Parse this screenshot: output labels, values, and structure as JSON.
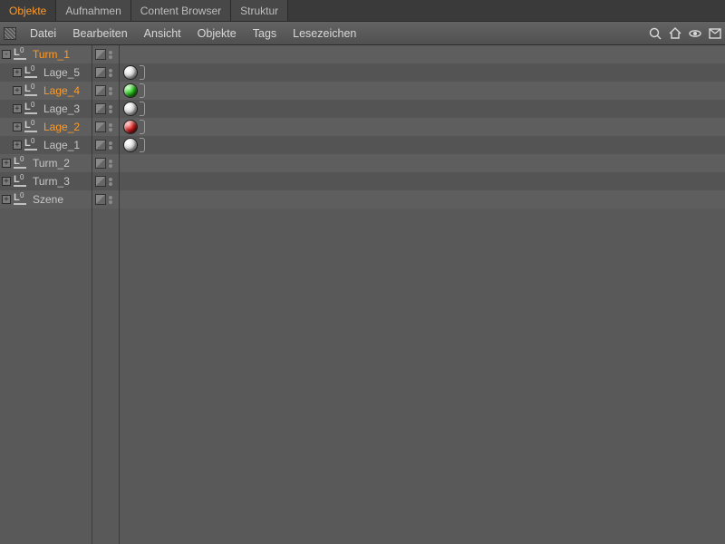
{
  "tabs": [
    {
      "label": "Objekte",
      "active": true
    },
    {
      "label": "Aufnahmen",
      "active": false
    },
    {
      "label": "Content Browser",
      "active": false
    },
    {
      "label": "Struktur",
      "active": false
    }
  ],
  "menu": {
    "items": [
      "Datei",
      "Bearbeiten",
      "Ansicht",
      "Objekte",
      "Tags",
      "Lesezeichen"
    ],
    "right_icons": [
      "search-icon",
      "home-icon",
      "eye-icon",
      "panel-icon"
    ]
  },
  "tree": [
    {
      "name": "Turm_1",
      "depth": 0,
      "expander": "-",
      "highlight": true,
      "tag": null
    },
    {
      "name": "Lage_5",
      "depth": 1,
      "expander": "+",
      "highlight": false,
      "tag": "white"
    },
    {
      "name": "Lage_4",
      "depth": 1,
      "expander": "+",
      "highlight": true,
      "tag": "green"
    },
    {
      "name": "Lage_3",
      "depth": 1,
      "expander": "+",
      "highlight": false,
      "tag": "white"
    },
    {
      "name": "Lage_2",
      "depth": 1,
      "expander": "+",
      "highlight": true,
      "tag": "red"
    },
    {
      "name": "Lage_1",
      "depth": 1,
      "expander": "+",
      "highlight": false,
      "tag": "white"
    },
    {
      "name": "Turm_2",
      "depth": 0,
      "expander": "+",
      "highlight": false,
      "tag": null
    },
    {
      "name": "Turm_3",
      "depth": 0,
      "expander": "+",
      "highlight": false,
      "tag": null
    },
    {
      "name": "Szene",
      "depth": 0,
      "expander": "+",
      "highlight": false,
      "tag": null
    }
  ]
}
